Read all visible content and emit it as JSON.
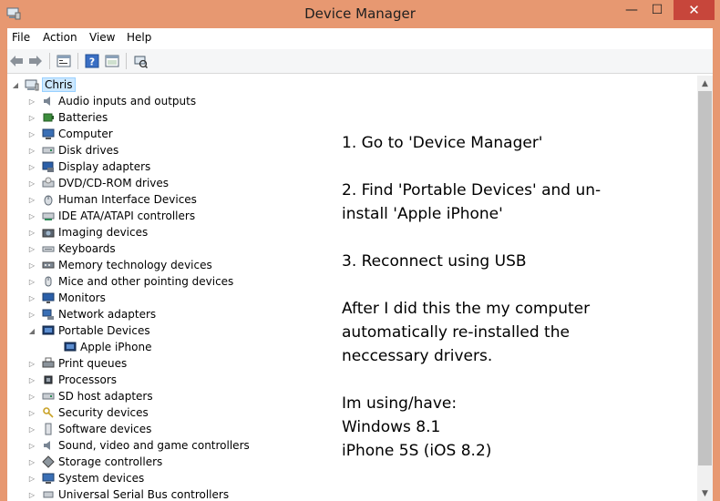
{
  "window": {
    "title": "Device Manager",
    "minimize_glyph": "—",
    "maximize_glyph": "☐",
    "close_glyph": "✕",
    "accent_color": "#e79871",
    "close_color": "#c7463b"
  },
  "menu": {
    "items": [
      "File",
      "Action",
      "View",
      "Help"
    ]
  },
  "toolbar": {
    "buttons": [
      "back-arrow-icon",
      "forward-arrow-icon",
      "properties-icon",
      "help-icon",
      "driver-details-icon",
      "scan-hardware-icon"
    ]
  },
  "tree": {
    "root": "Chris",
    "categories": [
      "Audio inputs and outputs",
      "Batteries",
      "Computer",
      "Disk drives",
      "Display adapters",
      "DVD/CD-ROM drives",
      "Human Interface Devices",
      "IDE ATA/ATAPI controllers",
      "Imaging devices",
      "Keyboards",
      "Memory technology devices",
      "Mice and other pointing devices",
      "Monitors",
      "Network adapters",
      "Portable Devices",
      "Print queues",
      "Processors",
      "SD host adapters",
      "Security devices",
      "Software devices",
      "Sound, video and game controllers",
      "Storage controllers",
      "System devices",
      "Universal Serial Bus controllers"
    ],
    "expanded_category": "Portable Devices",
    "child_of_expanded": "Apple iPhone"
  },
  "notes": {
    "steps": [
      [
        "1. Go to 'Device Manager'"
      ],
      [
        "2. Find 'Portable Devices' and un-",
        "install 'Apple iPhone'"
      ],
      [
        "3. Reconnect using USB"
      ],
      [
        "After I did this the my computer",
        "automatically re-installed the",
        "neccessary drivers."
      ],
      [
        "Im using/have:",
        "Windows 8.1",
        "iPhone 5S (iOS 8.2)"
      ]
    ]
  }
}
